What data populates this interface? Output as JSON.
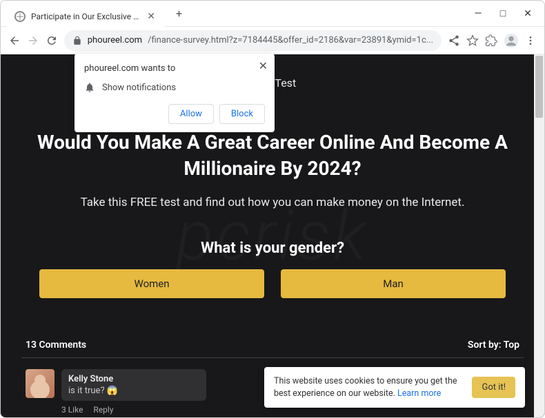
{
  "window": {
    "tab_title": "Participate in Our Exclusive Onlin",
    "controls": {
      "minimize": "—",
      "maximize": "□",
      "close": "✕"
    }
  },
  "toolbar": {
    "url_domain": "phoureel.com",
    "url_path": "/finance-survey.html?z=7184445&offer_id=2186&var=23891&ymid=1c..."
  },
  "notification": {
    "title": "phoureel.com wants to",
    "message": "Show notifications",
    "allow": "Allow",
    "block": "Block"
  },
  "page": {
    "top_label_suffix": "nline Test",
    "headline": "Would You Make A Great Career Online And Become A Millionaire By 2024?",
    "subhead": "Take this FREE test and find out how you can make money on the Internet.",
    "question": "What is your gender?",
    "option_women": "Women",
    "option_man": "Man"
  },
  "comments": {
    "count_label": "13 Comments",
    "sort_label": "Sort by: Top",
    "first": {
      "author": "Kelly Stone",
      "text": "is it true? 😱",
      "likes_label": "3 Like",
      "reply_label": "Reply"
    }
  },
  "cookie": {
    "text": "This website uses cookies to ensure you get the best experience on our website. ",
    "link": "Learn more",
    "button": "Got it!"
  },
  "watermark": "pcrisk"
}
